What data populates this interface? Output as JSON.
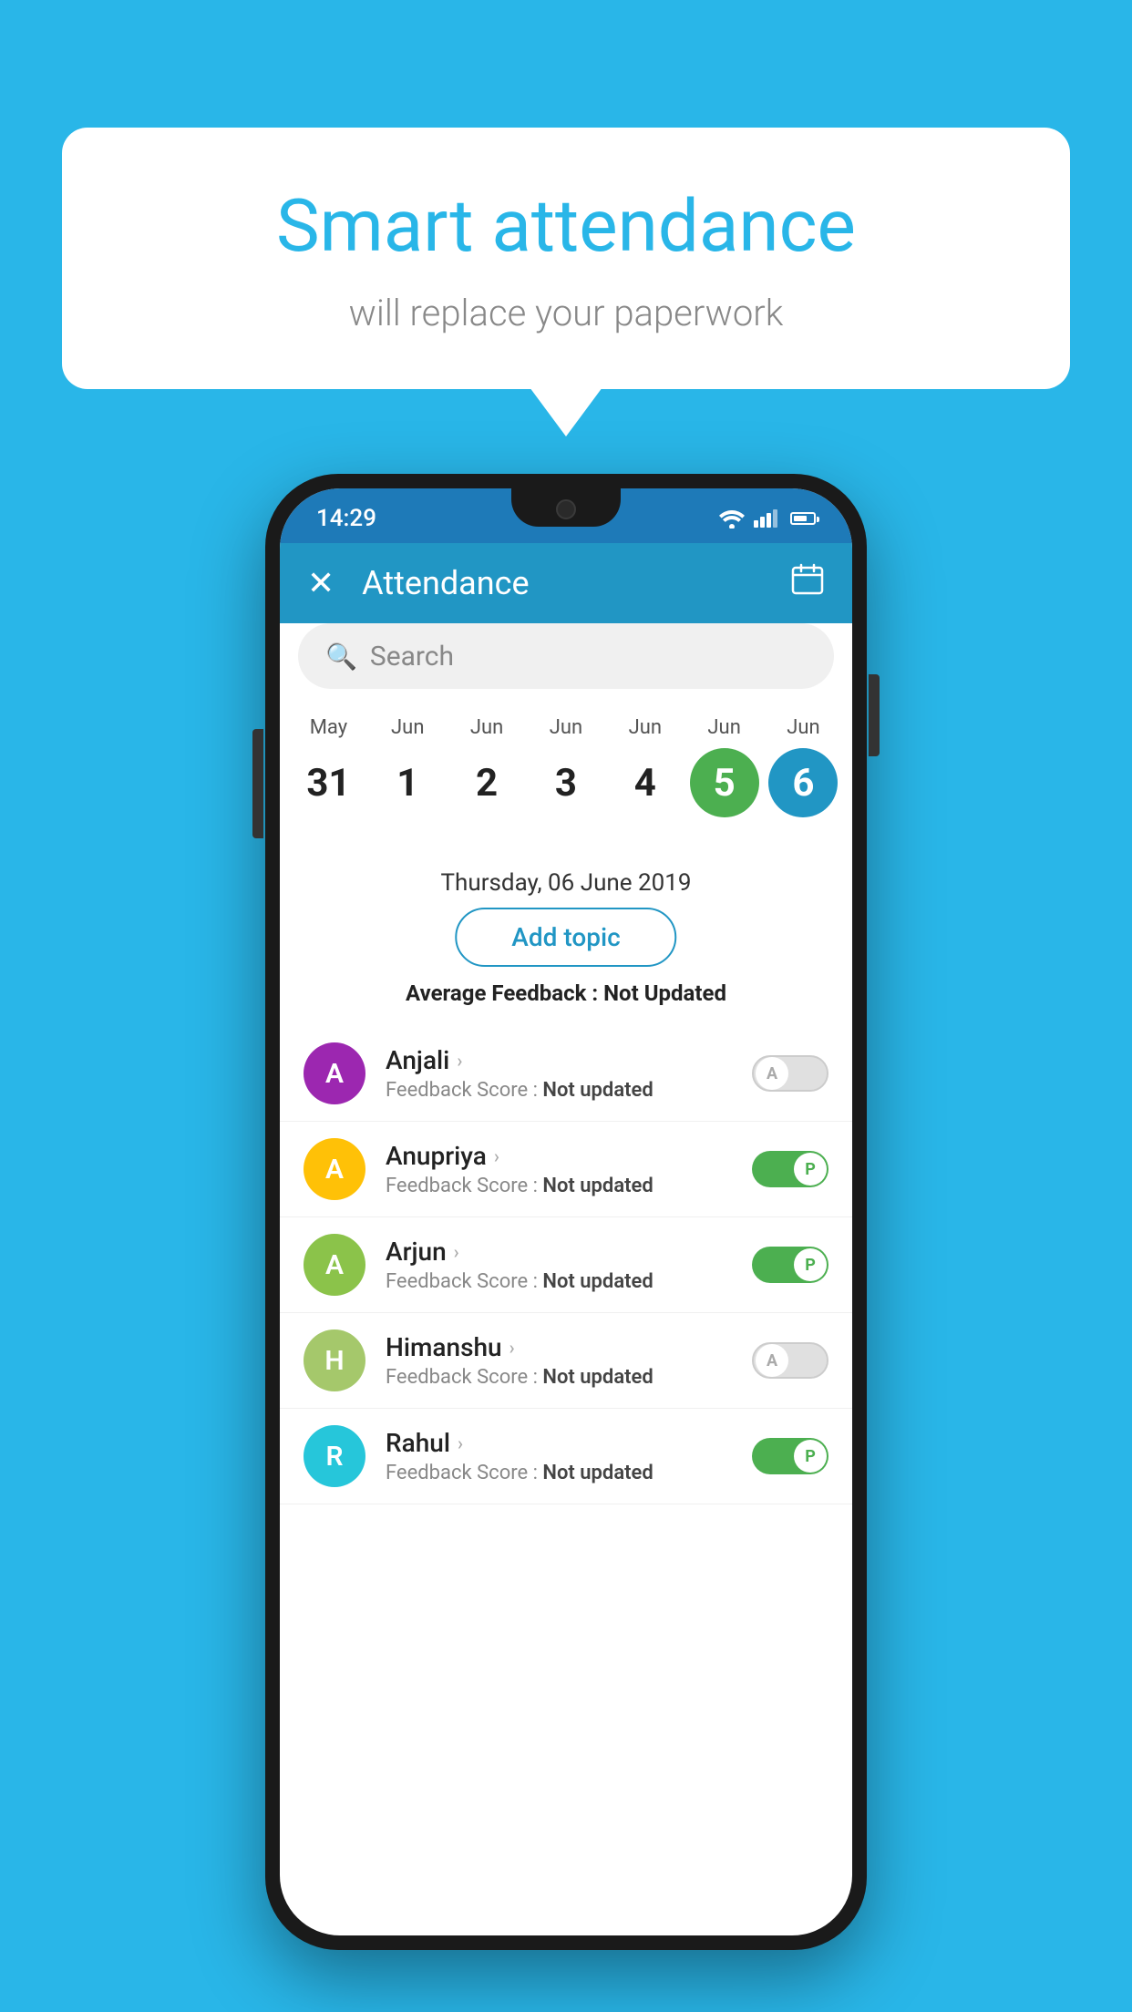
{
  "background_color": "#29b6e8",
  "bubble": {
    "title": "Smart attendance",
    "subtitle": "will replace your paperwork"
  },
  "status_bar": {
    "time": "14:29"
  },
  "header": {
    "title": "Attendance",
    "close_label": "×",
    "calendar_label": "📅"
  },
  "search": {
    "placeholder": "Search"
  },
  "calendar": {
    "days": [
      {
        "month": "May",
        "num": "31",
        "state": "normal"
      },
      {
        "month": "Jun",
        "num": "1",
        "state": "normal"
      },
      {
        "month": "Jun",
        "num": "2",
        "state": "normal"
      },
      {
        "month": "Jun",
        "num": "3",
        "state": "normal"
      },
      {
        "month": "Jun",
        "num": "4",
        "state": "normal"
      },
      {
        "month": "Jun",
        "num": "5",
        "state": "today"
      },
      {
        "month": "Jun",
        "num": "6",
        "state": "selected"
      }
    ]
  },
  "selected_date": "Thursday, 06 June 2019",
  "add_topic_label": "Add topic",
  "avg_feedback_label": "Average Feedback :",
  "avg_feedback_value": "Not Updated",
  "students": [
    {
      "name": "Anjali",
      "avatar_letter": "A",
      "avatar_color": "#9c27b0",
      "feedback_label": "Feedback Score :",
      "feedback_value": "Not updated",
      "toggle": "off",
      "toggle_letter": "A"
    },
    {
      "name": "Anupriya",
      "avatar_letter": "A",
      "avatar_color": "#ffc107",
      "feedback_label": "Feedback Score :",
      "feedback_value": "Not updated",
      "toggle": "on",
      "toggle_letter": "P"
    },
    {
      "name": "Arjun",
      "avatar_letter": "A",
      "avatar_color": "#8bc34a",
      "feedback_label": "Feedback Score :",
      "feedback_value": "Not updated",
      "toggle": "on",
      "toggle_letter": "P"
    },
    {
      "name": "Himanshu",
      "avatar_letter": "H",
      "avatar_color": "#a5c86b",
      "feedback_label": "Feedback Score :",
      "feedback_value": "Not updated",
      "toggle": "off",
      "toggle_letter": "A"
    },
    {
      "name": "Rahul",
      "avatar_letter": "R",
      "avatar_color": "#26c6da",
      "feedback_label": "Feedback Score :",
      "feedback_value": "Not updated",
      "toggle": "on",
      "toggle_letter": "P"
    }
  ]
}
